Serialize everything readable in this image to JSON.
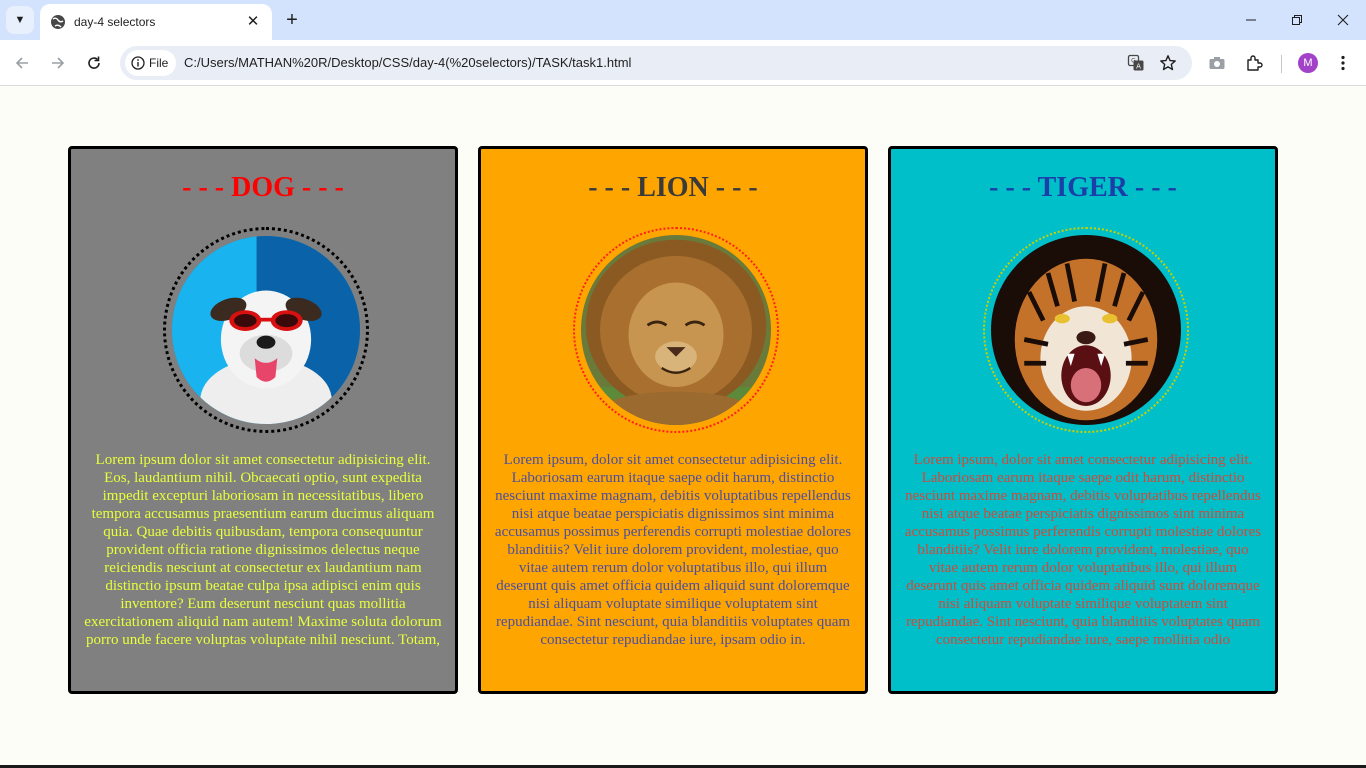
{
  "browser": {
    "tab_title": "day-4 selectors",
    "site_chip_label": "File",
    "url": "C:/Users/MATHAN%20R/Desktop/CSS/day-4(%20selectors)/TASK/task1.html",
    "profile_initial": "M",
    "icons": [
      "tab-list",
      "globe",
      "close",
      "plus",
      "minimize",
      "restore",
      "back",
      "forward",
      "reload",
      "info",
      "translate",
      "star",
      "camera",
      "extensions",
      "menu"
    ]
  },
  "colors": {
    "dog_card_bg": "#808080",
    "dog_title": "#ff0000",
    "dog_text": "#e6ff3a",
    "lion_card_bg": "#ffa500",
    "lion_title": "#3a3a3a",
    "lion_text": "#4a4fa0",
    "tiger_card_bg": "#00bfc8",
    "tiger_title": "#1a3fa8",
    "tiger_text": "#d04a3a"
  },
  "cards": [
    {
      "title": "- - - DOG - - -",
      "text": "Lorem ipsum dolor sit amet consectetur adipisicing elit. Eos, laudantium nihil. Obcaecati optio, sunt expedita impedit excepturi laboriosam in necessitatibus, libero tempora accusamus praesentium earum ducimus aliquam quia. Quae debitis quibusdam, tempora consequuntur provident officia ratione dignissimos delectus neque reiciendis nesciunt at consectetur ex laudantium nam distinctio ipsum beatae culpa ipsa adipisci enim quis inventore? Eum deserunt nesciunt quas mollitia exercitationem aliquid nam autem! Maxime soluta dolorum porro unde facere voluptas voluptate nihil nesciunt. Totam,"
    },
    {
      "title": "- - - LION - - -",
      "text": "Lorem ipsum, dolor sit amet consectetur adipisicing elit. Laboriosam earum itaque saepe odit harum, distinctio nesciunt maxime magnam, debitis voluptatibus repellendus nisi atque beatae perspiciatis dignissimos sint minima accusamus possimus perferendis corrupti molestiae dolores blanditiis? Velit iure dolorem provident, molestiae, quo vitae autem rerum dolor voluptatibus illo, qui illum deserunt quis amet officia quidem aliquid sunt doloremque nisi aliquam voluptate similique voluptatem sint repudiandae. Sint nesciunt, quia blanditiis voluptates quam consectetur repudiandae iure, ipsam odio in."
    },
    {
      "title": "- - - TIGER - - -",
      "text": "Lorem ipsum, dolor sit amet consectetur adipisicing elit. Laboriosam earum itaque saepe odit harum, distinctio nesciunt maxime magnam, debitis voluptatibus repellendus nisi atque beatae perspiciatis dignissimos sint minima accusamus possimus perferendis corrupti molestiae dolores blanditiis? Velit iure dolorem provident, molestiae, quo vitae autem rerum dolor voluptatibus illo, qui illum deserunt quis amet officia quidem aliquid sunt doloremque nisi aliquam voluptate similique voluptatem sint repudiandae. Sint nesciunt, quia blanditiis voluptates quam consectetur repudiandae iure, saepe mollitia odio"
    }
  ]
}
